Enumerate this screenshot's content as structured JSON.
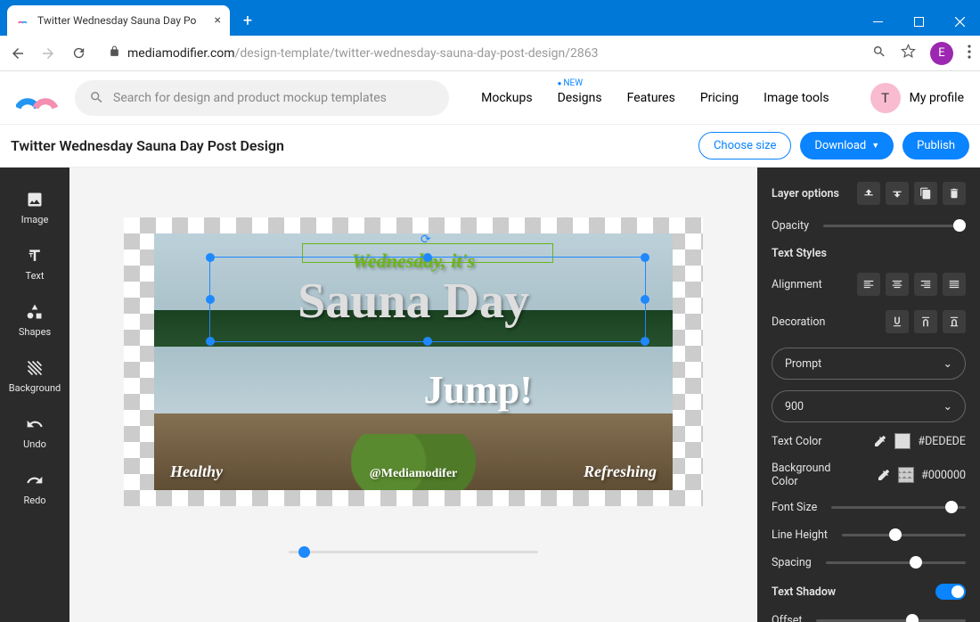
{
  "browser": {
    "tab_title": "Twitter Wednesday Sauna Day Po",
    "url_host": "mediamodifier.com",
    "url_path": "/design-template/twitter-wednesday-sauna-day-post-design/2863",
    "avatar_letter": "E"
  },
  "header": {
    "search_placeholder": "Search for design and product mockup templates",
    "nav": {
      "mockups": "Mockups",
      "designs": "Designs",
      "designs_badge": "NEW",
      "features": "Features",
      "pricing": "Pricing",
      "image_tools": "Image tools"
    },
    "profile_letter": "T",
    "profile_label": "My profile"
  },
  "doc": {
    "title": "Twitter Wednesday Sauna Day Post Design",
    "choose_size": "Choose size",
    "download": "Download",
    "publish": "Publish"
  },
  "tools": {
    "image": "Image",
    "text": "Text",
    "shapes": "Shapes",
    "background": "Background",
    "undo": "Undo",
    "redo": "Redo"
  },
  "canvas": {
    "text_pre": "Wednesday, it's",
    "text_main": "Sauna Day",
    "text_jump": "Jump!",
    "text_healthy": "Healthy",
    "text_handle": "@Mediamodifer",
    "text_refreshing": "Refreshing"
  },
  "panel": {
    "layer_options": "Layer options",
    "opacity": "Opacity",
    "text_styles": "Text Styles",
    "alignment": "Alignment",
    "decoration": "Decoration",
    "font_family": "Prompt",
    "font_weight": "900",
    "text_color_label": "Text Color",
    "text_color": "#DEDEDE",
    "bg_color_label": "Background Color",
    "bg_color": "#000000",
    "font_size": "Font Size",
    "line_height": "Line Height",
    "spacing": "Spacing",
    "text_shadow": "Text Shadow",
    "offset": "Offset"
  }
}
